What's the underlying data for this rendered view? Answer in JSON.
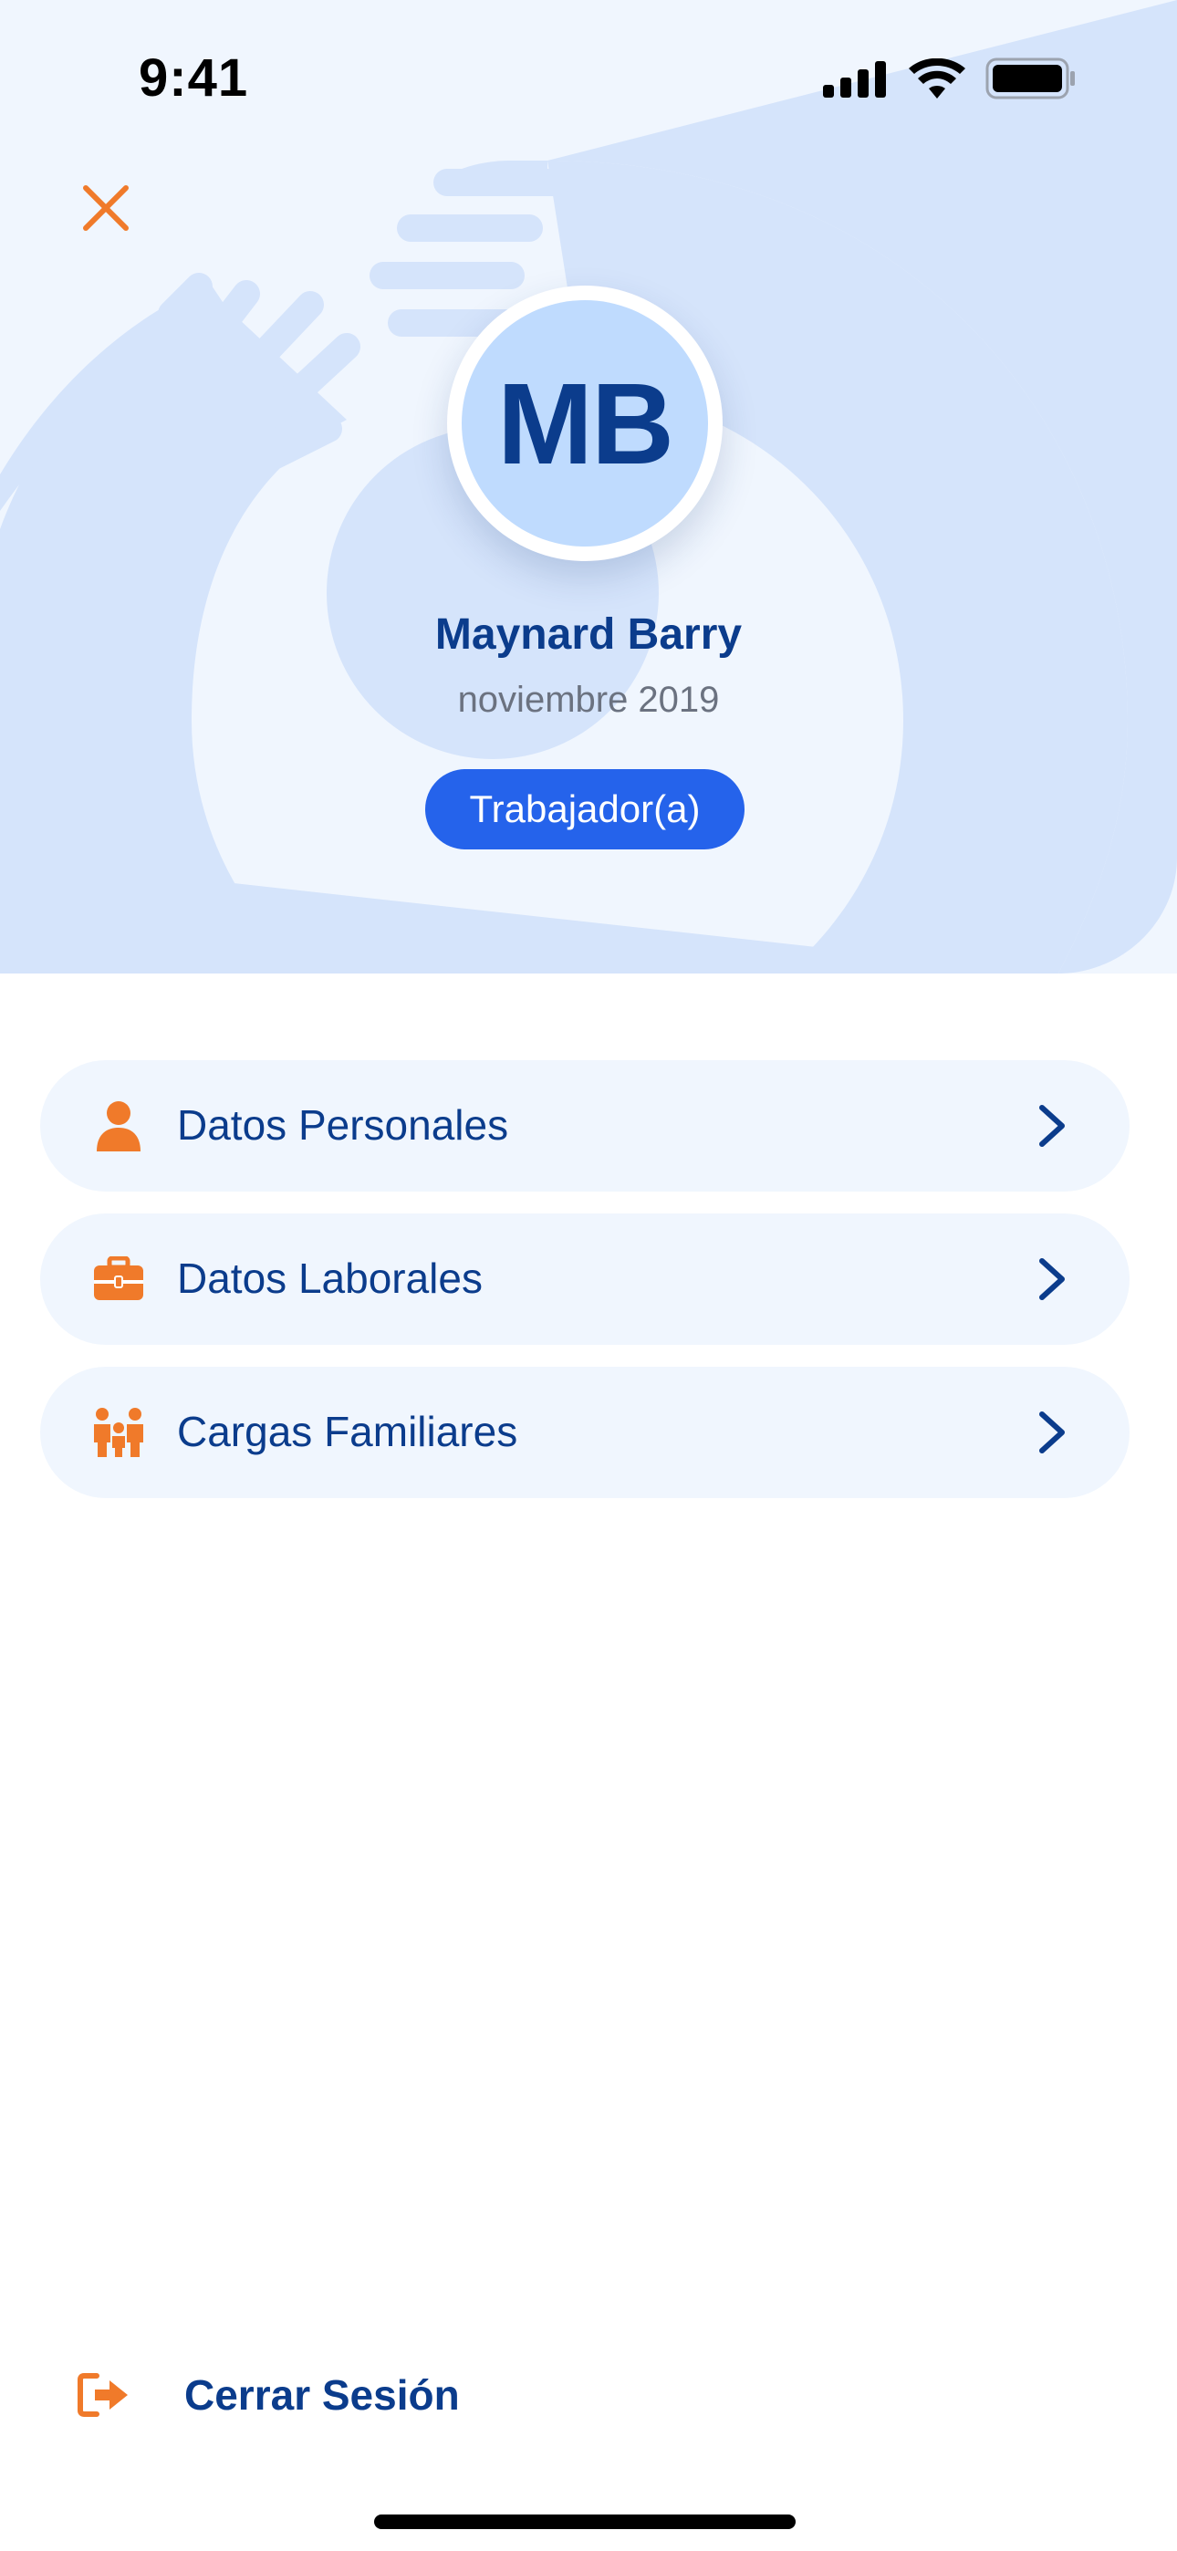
{
  "status_bar": {
    "time": "9:41",
    "icons": [
      "signal-icon",
      "wifi-icon",
      "battery-icon"
    ]
  },
  "header": {
    "close_icon": "close-icon",
    "avatar_initials": "MB",
    "user_name": "Maynard Barry",
    "since_date": "noviembre 2019",
    "role": "Trabajador(a)"
  },
  "menu": {
    "items": [
      {
        "label": "Datos Personales",
        "icon": "person-icon"
      },
      {
        "label": "Datos Laborales",
        "icon": "briefcase-icon"
      },
      {
        "label": "Cargas Familiares",
        "icon": "family-icon"
      }
    ]
  },
  "footer": {
    "logout_label": "Cerrar Sesión",
    "logout_icon": "logout-icon"
  },
  "colors": {
    "primary": "#0b3c8c",
    "accent": "#f07a2a",
    "badge": "#2563eb",
    "hero_bg": "#f0f6fe",
    "shape": "#d5e4fb"
  }
}
